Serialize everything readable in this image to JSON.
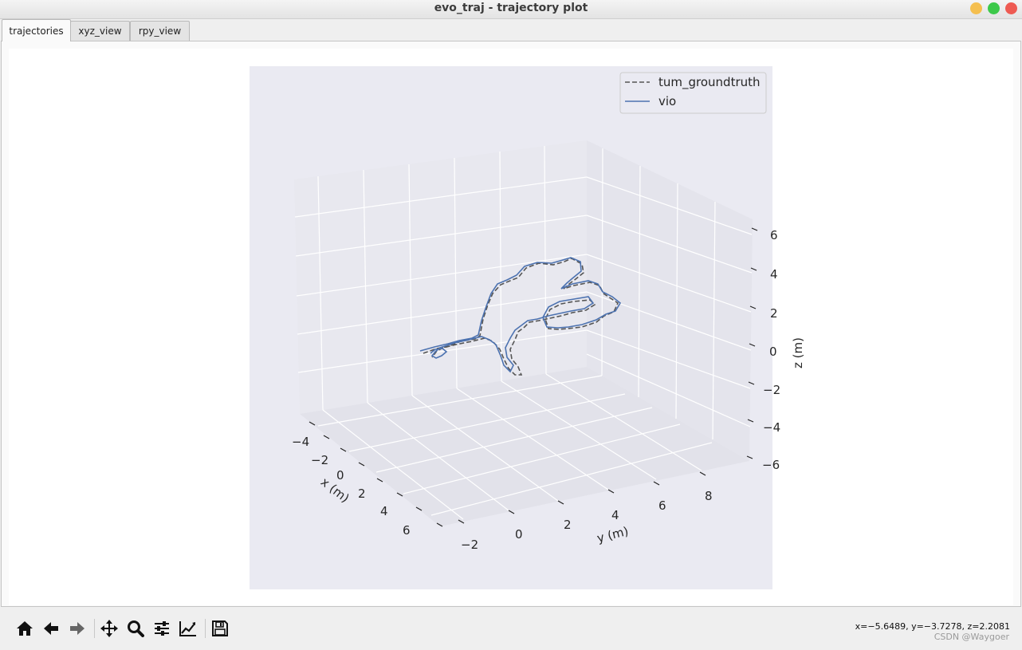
{
  "window": {
    "title": "evo_traj - trajectory plot",
    "buttons": [
      {
        "name": "minimize",
        "color": "#f5bf4f"
      },
      {
        "name": "maximize",
        "color": "#3dc94a"
      },
      {
        "name": "close",
        "color": "#ee5a52"
      }
    ]
  },
  "tabs": [
    {
      "label": "trajectories",
      "active": true
    },
    {
      "label": "xyz_view",
      "active": false
    },
    {
      "label": "rpy_view",
      "active": false
    }
  ],
  "chart_data": {
    "type": "line3d",
    "xlabel": "x (m)",
    "ylabel": "y (m)",
    "zlabel": "z (m)",
    "x_ticks": [
      "−4",
      "−2",
      "0",
      "2",
      "4",
      "6"
    ],
    "y_ticks": [
      "−2",
      "0",
      "2",
      "4",
      "6",
      "8"
    ],
    "z_ticks": [
      "6",
      "4",
      "2",
      "0",
      "−2",
      "−4",
      "−6"
    ],
    "legend": [
      {
        "name": "tum_groundtruth",
        "style": "dashed",
        "color": "#555555"
      },
      {
        "name": "vio",
        "style": "solid",
        "color": "#4c72b0"
      }
    ],
    "legend_position": "top-right",
    "background": "#eaeaf2",
    "grid": true
  },
  "toolbar": {
    "icons": [
      "home-icon",
      "back-arrow-icon",
      "forward-arrow-icon",
      "pan-icon",
      "zoom-icon",
      "configure-subplots-icon",
      "edit-axes-icon",
      "save-icon"
    ],
    "coords": "x=−5.6489, y=−3.7278, z=2.2081",
    "watermark": "CSDN @Waygoer"
  }
}
